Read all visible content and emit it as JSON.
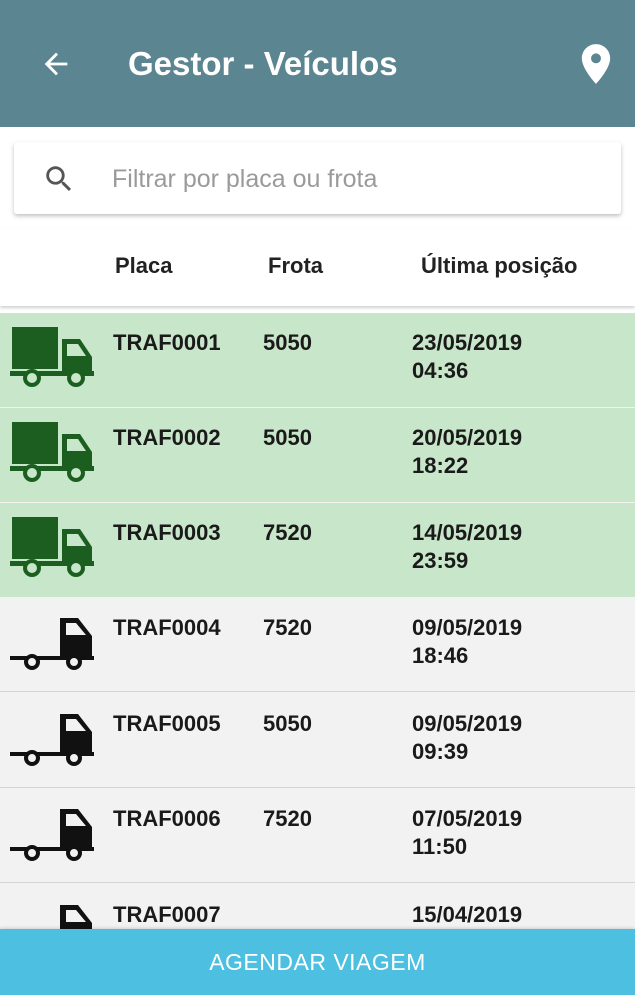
{
  "appbar": {
    "title": "Gestor - Veículos",
    "icons": {
      "back": "arrow-left-icon",
      "location": "map-pin-icon"
    }
  },
  "search": {
    "placeholder": "Filtrar por placa ou frota",
    "value": "",
    "icon": "search-icon"
  },
  "table": {
    "headers": {
      "placa": "Placa",
      "frota": "Frota",
      "ultima_posicao": "Última posição"
    }
  },
  "vehicles": [
    {
      "placa": "TRAF0001",
      "frota": "5050",
      "date": "23/05/2019",
      "time": "04:36",
      "status": "active",
      "icon": "truck-icon"
    },
    {
      "placa": "TRAF0002",
      "frota": "5050",
      "date": "20/05/2019",
      "time": "18:22",
      "status": "active",
      "icon": "truck-icon"
    },
    {
      "placa": "TRAF0003",
      "frota": "7520",
      "date": "14/05/2019",
      "time": "23:59",
      "status": "active",
      "icon": "truck-icon"
    },
    {
      "placa": "TRAF0004",
      "frota": "7520",
      "date": "09/05/2019",
      "time": "18:46",
      "status": "inactive",
      "icon": "tractor-truck-icon"
    },
    {
      "placa": "TRAF0005",
      "frota": "5050",
      "date": "09/05/2019",
      "time": "09:39",
      "status": "inactive",
      "icon": "tractor-truck-icon"
    },
    {
      "placa": "TRAF0006",
      "frota": "7520",
      "date": "07/05/2019",
      "time": "11:50",
      "status": "inactive",
      "icon": "tractor-truck-icon"
    },
    {
      "placa": "TRAF0007",
      "frota": "",
      "date": "15/04/2019",
      "time": "",
      "status": "inactive",
      "icon": "tractor-truck-icon"
    }
  ],
  "colors": {
    "appbar": "#5b8591",
    "active_row": "#c8e6c9",
    "active_truck": "#1b5e20",
    "inactive_truck": "#111111",
    "button": "#4dbfe0"
  },
  "footer": {
    "button_label": "AGENDAR VIAGEM"
  }
}
